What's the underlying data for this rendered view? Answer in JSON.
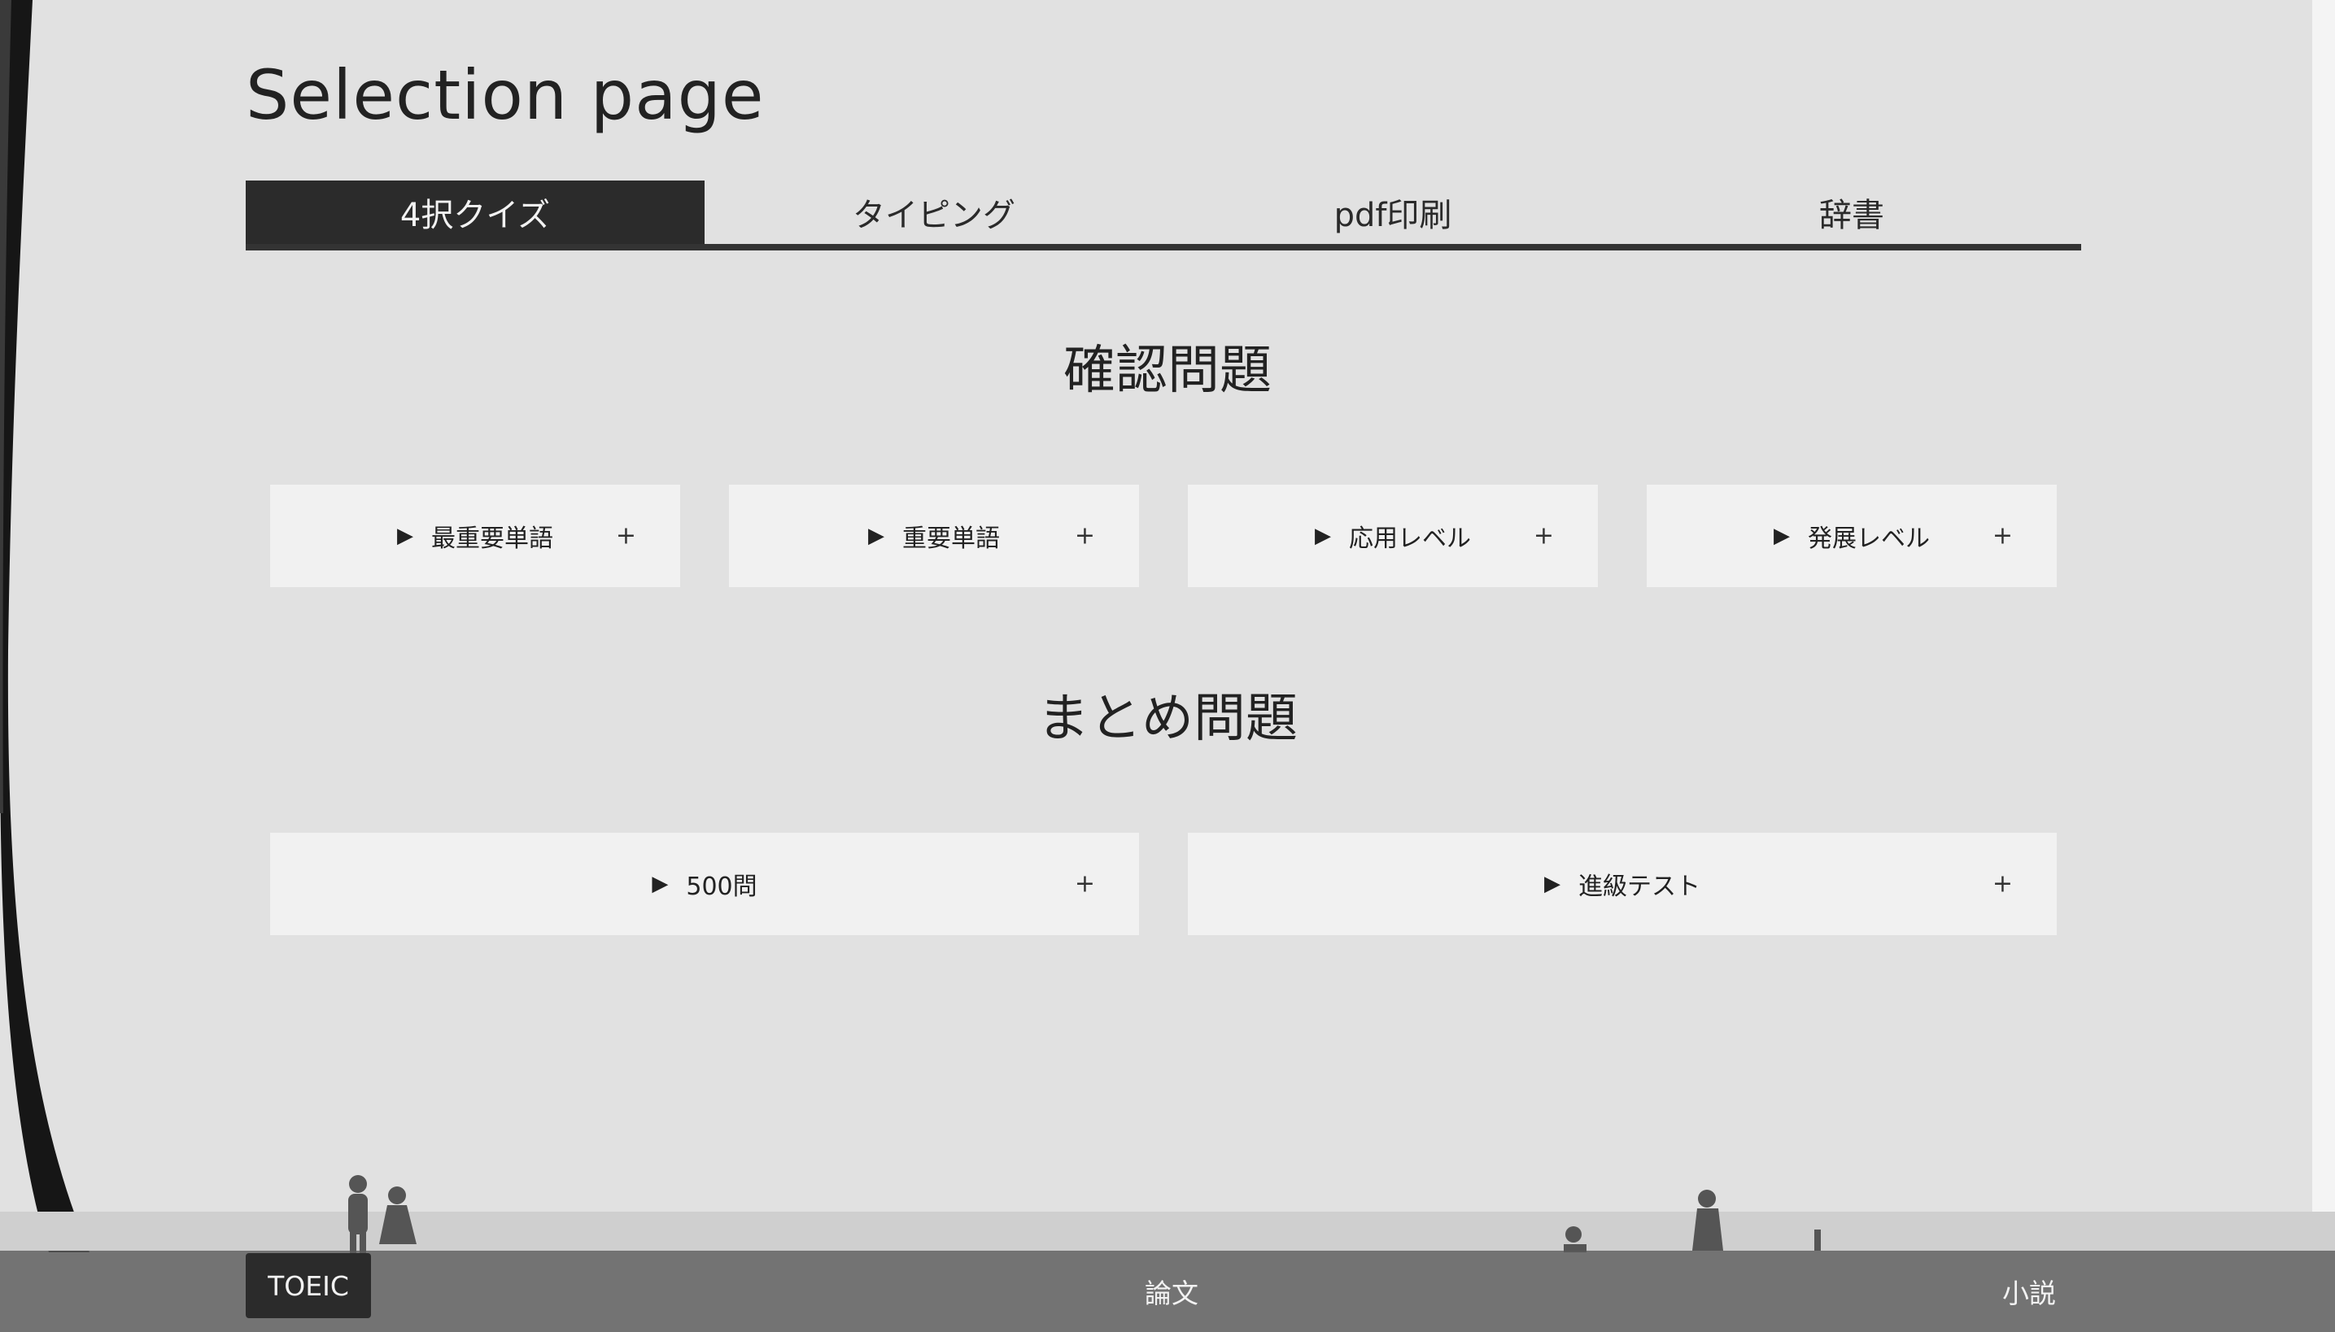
{
  "page": {
    "title": "Selection page"
  },
  "tabs": [
    {
      "label": "4択クイズ",
      "active": true
    },
    {
      "label": "タイピング",
      "active": false
    },
    {
      "label": "pdf印刷",
      "active": false
    },
    {
      "label": "辞書",
      "active": false
    }
  ],
  "sections": [
    {
      "heading": "確認問題",
      "cards": [
        {
          "label": "最重要単語",
          "arrow": "▶",
          "plus": "+"
        },
        {
          "label": "重要単語",
          "arrow": "▶",
          "plus": "+"
        },
        {
          "label": "応用レベル",
          "arrow": "▶",
          "plus": "+"
        },
        {
          "label": "発展レベル",
          "arrow": "▶",
          "plus": "+"
        }
      ]
    },
    {
      "heading": "まとめ問題",
      "cards": [
        {
          "label": "500問",
          "arrow": "▶",
          "plus": "+"
        },
        {
          "label": "進級テスト",
          "arrow": "▶",
          "plus": "+"
        }
      ]
    }
  ],
  "footer": {
    "items": [
      {
        "label": "TOEIC",
        "active": true
      },
      {
        "label": "論文",
        "active": false
      },
      {
        "label": "小説",
        "active": false
      }
    ]
  },
  "colors": {
    "background": "#e1e1e1",
    "active_tab": "#2b2b2b",
    "card": "#f1f1f1",
    "footer": "#5a5a5a"
  },
  "icons": {
    "card_arrow": "play-triangle-icon",
    "card_expand": "plus-icon"
  }
}
